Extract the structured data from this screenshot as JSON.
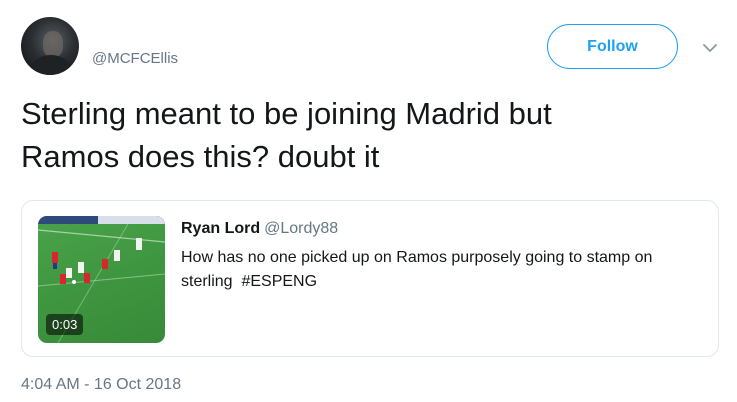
{
  "author": {
    "handle": "@MCFCEllis",
    "avatar_icon": "profile-photo"
  },
  "header": {
    "follow_label": "Follow",
    "more_icon": "chevron-down-icon"
  },
  "tweet": {
    "text": "Sterling meant to be joining Madrid but\nRamos does this? doubt it",
    "timestamp": "4:04 AM - 16 Oct 2018"
  },
  "quoted_tweet": {
    "name": "Ryan Lord",
    "handle": "@Lordy88",
    "text_line1": "How has no one picked up on Ramos purposely going to stamp on",
    "text_line2": "sterling  #ESPENG",
    "video_duration": "0:03"
  },
  "colors": {
    "accent": "#1da1f2",
    "secondary_text": "#657786",
    "border": "#e1e8ed"
  }
}
